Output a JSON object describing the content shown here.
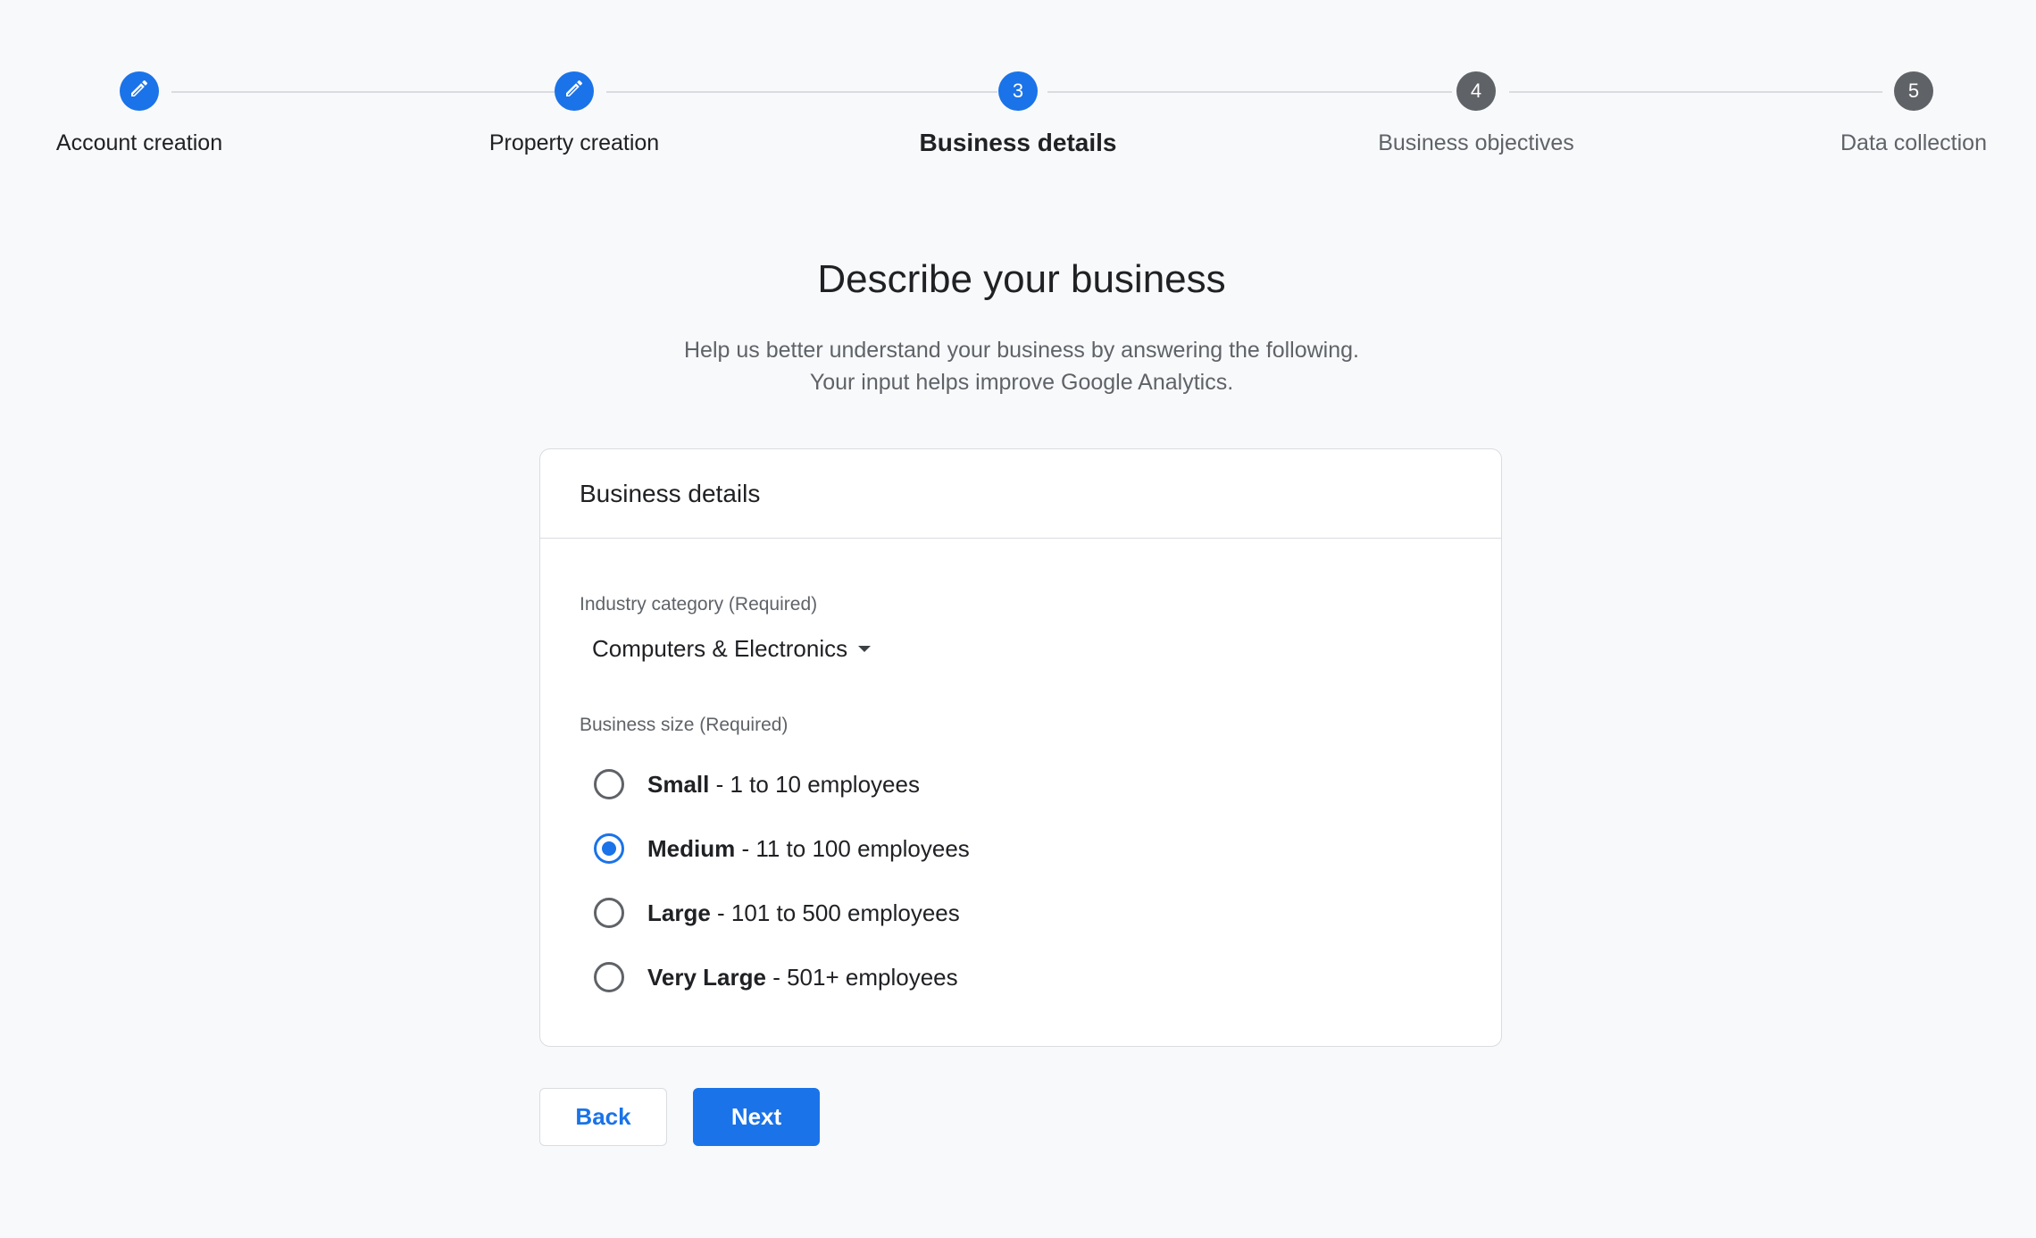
{
  "colors": {
    "accent": "#1a73e8",
    "pending_step": "#5f6368",
    "background": "#f8f9fa",
    "card_border": "#dadce0"
  },
  "stepper": {
    "steps": [
      {
        "label": "Account creation",
        "marker": "",
        "state": "done",
        "icon": "pencil-icon"
      },
      {
        "label": "Property creation",
        "marker": "",
        "state": "done",
        "icon": "pencil-icon"
      },
      {
        "label": "Business details",
        "marker": "3",
        "state": "active"
      },
      {
        "label": "Business objectives",
        "marker": "4",
        "state": "todo"
      },
      {
        "label": "Data collection",
        "marker": "5",
        "state": "todo"
      }
    ]
  },
  "page": {
    "title": "Describe your business",
    "subtitle_line1": "Help us better understand your business by answering the following.",
    "subtitle_line2": "Your input helps improve Google Analytics."
  },
  "card": {
    "title": "Business details",
    "industry": {
      "label": "Industry category (Required)",
      "selected": "Computers & Electronics",
      "icon": "dropdown-caret-icon"
    },
    "size": {
      "label": "Business size (Required)",
      "options": [
        {
          "name": "Small",
          "detail": " - 1 to 10 employees",
          "selected": false
        },
        {
          "name": "Medium",
          "detail": " - 11 to 100 employees",
          "selected": true
        },
        {
          "name": "Large",
          "detail": " - 101 to 500 employees",
          "selected": false
        },
        {
          "name": "Very Large",
          "detail": " - 501+ employees",
          "selected": false
        }
      ]
    }
  },
  "actions": {
    "back_label": "Back",
    "next_label": "Next"
  }
}
